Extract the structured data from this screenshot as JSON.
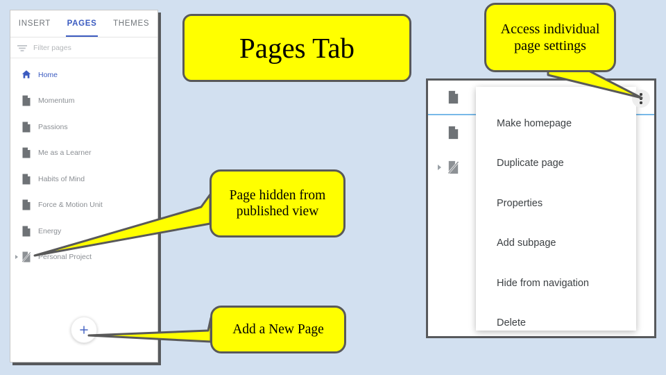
{
  "canvas": {
    "background_color": "#d2e0f0",
    "callout_fill": "#ffff00",
    "callout_border": "#595959"
  },
  "pages_panel": {
    "tabs": [
      {
        "label": "INSERT",
        "active": false
      },
      {
        "label": "PAGES",
        "active": true
      },
      {
        "label": "THEMES",
        "active": false
      }
    ],
    "filter": {
      "placeholder": "Filter pages",
      "icon": "filter-icon"
    },
    "items": [
      {
        "label": "Home",
        "icon": "home-icon",
        "hidden": false,
        "expandable": false
      },
      {
        "label": "Momentum",
        "icon": "page-icon",
        "hidden": false,
        "expandable": false
      },
      {
        "label": "Passions",
        "icon": "page-icon",
        "hidden": false,
        "expandable": false
      },
      {
        "label": "Me as a Learner",
        "icon": "page-icon",
        "hidden": false,
        "expandable": false
      },
      {
        "label": "Habits of Mind",
        "icon": "page-icon",
        "hidden": false,
        "expandable": false
      },
      {
        "label": "Force & Motion Unit",
        "icon": "page-icon",
        "hidden": false,
        "expandable": false
      },
      {
        "label": "Energy",
        "icon": "page-icon",
        "hidden": false,
        "expandable": false
      },
      {
        "label": "Personal Project",
        "icon": "page-hidden-icon",
        "hidden": true,
        "expandable": true
      }
    ],
    "add_page_button": {
      "icon": "plus-icon",
      "accent_color": "#3b5bc0"
    },
    "accent_color": "#3b5bc0"
  },
  "menu_panel": {
    "rows": [
      {
        "icon": "page-icon",
        "label": "",
        "selected": true,
        "expandable": false
      },
      {
        "icon": "page-icon",
        "label": "",
        "selected": false,
        "expandable": false
      },
      {
        "icon": "page-hidden-icon",
        "label": "",
        "selected": false,
        "expandable": true
      }
    ],
    "kebab_icon": "more-vert-icon",
    "context_menu": {
      "items": [
        "Make homepage",
        "Duplicate page",
        "Properties",
        "Add subpage",
        "Hide from navigation",
        "Delete"
      ]
    }
  },
  "callouts": {
    "pages_tab": "Pages Tab",
    "access_settings": "Access individual page settings",
    "page_hidden": "Page hidden from published view",
    "add_new_page": "Add a New Page"
  }
}
